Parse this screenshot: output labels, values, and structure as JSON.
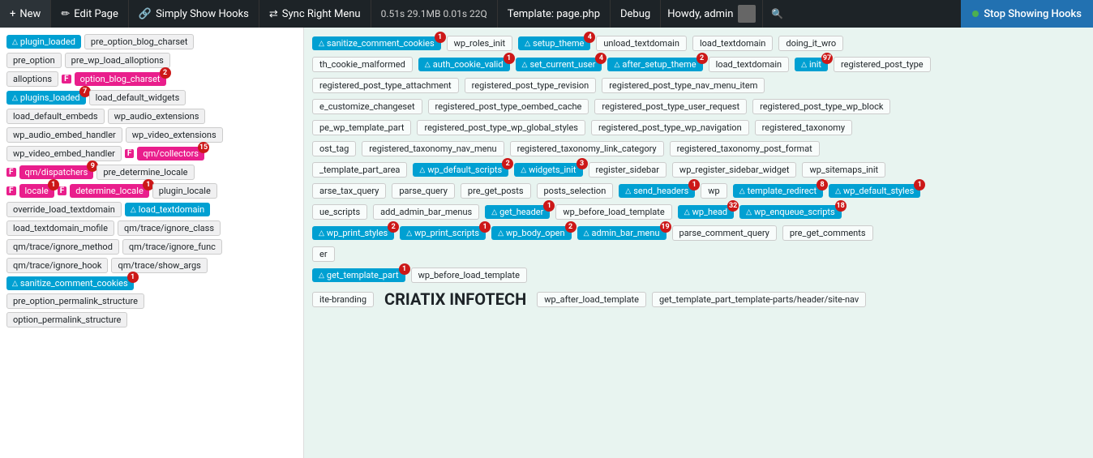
{
  "toolbar": {
    "new_label": "New",
    "edit_page_label": "Edit Page",
    "simply_show_hooks_label": "Simply Show Hooks",
    "sync_right_menu_label": "Sync Right Menu",
    "stats": "0.51s  29.1MB  0.01s  22Q",
    "template_label": "Template:  page.php",
    "debug_label": "Debug",
    "admin_label": "Howdy, admin",
    "stop_hooks_label": "Stop Showing Hooks"
  },
  "left_hooks": [
    [
      {
        "text": "plugin_loaded",
        "type": "action"
      },
      {
        "text": "pre_option_blog_charset",
        "type": "neutral"
      }
    ],
    [
      {
        "text": "pre_option",
        "type": "neutral"
      },
      {
        "text": "pre_wp_load_alloptions",
        "type": "neutral"
      }
    ],
    [
      {
        "text": "alloptions",
        "type": "neutral"
      },
      {
        "text": "F",
        "type": "f-prefix"
      },
      {
        "text": "option_blog_charset",
        "type": "filter",
        "badge": "2"
      }
    ],
    [
      {
        "text": "plugins_loaded",
        "type": "action",
        "badge": "7"
      },
      {
        "text": "load_default_widgets",
        "type": "neutral"
      }
    ],
    [
      {
        "text": "load_default_embeds",
        "type": "neutral"
      },
      {
        "text": "wp_audio_extensions",
        "type": "neutral"
      }
    ],
    [
      {
        "text": "wp_audio_embed_handler",
        "type": "neutral"
      },
      {
        "text": "wp_video_extensions",
        "type": "neutral"
      }
    ],
    [
      {
        "text": "wp_video_embed_handler",
        "type": "neutral"
      },
      {
        "text": "F",
        "type": "f-prefix"
      },
      {
        "text": "qm/collectors",
        "type": "filter",
        "badge": "15"
      }
    ],
    [
      {
        "text": "F",
        "type": "f-prefix"
      },
      {
        "text": "qm/dispatchers",
        "type": "filter",
        "badge": "9"
      },
      {
        "text": "pre_determine_locale",
        "type": "neutral"
      }
    ],
    [
      {
        "text": "F",
        "type": "f-prefix"
      },
      {
        "text": "locale",
        "type": "filter",
        "badge": "1"
      },
      {
        "text": "F",
        "type": "f-prefix"
      },
      {
        "text": "determine_locale",
        "type": "filter",
        "badge": "1"
      },
      {
        "text": "plugin_locale",
        "type": "neutral"
      }
    ],
    [
      {
        "text": "override_load_textdomain",
        "type": "neutral"
      },
      {
        "text": "load_textdomain",
        "type": "action"
      }
    ],
    [
      {
        "text": "load_textdomain_mofile",
        "type": "neutral"
      },
      {
        "text": "qm/trace/ignore_class",
        "type": "neutral"
      }
    ],
    [
      {
        "text": "qm/trace/ignore_method",
        "type": "neutral"
      },
      {
        "text": "qm/trace/ignore_func",
        "type": "neutral"
      }
    ],
    [
      {
        "text": "qm/trace/ignore_hook",
        "type": "neutral"
      },
      {
        "text": "qm/trace/show_args",
        "type": "neutral"
      }
    ],
    [
      {
        "text": "sanitize_comment_cookies",
        "type": "action",
        "badge": "1"
      }
    ],
    [
      {
        "text": "pre_option_permalink_structure",
        "type": "neutral"
      }
    ],
    [
      {
        "text": "option_permalink_structure",
        "type": "neutral"
      }
    ]
  ],
  "right_hooks": [
    {
      "line": [
        {
          "text": "sanitize_comment_cookies",
          "type": "action",
          "badge": "1"
        },
        {
          "text": "wp_roles_init",
          "type": "neutral"
        },
        {
          "text": "setup_theme",
          "type": "action",
          "badge": "4"
        },
        {
          "text": "unload_textdomain",
          "type": "neutral"
        },
        {
          "text": "load_textdomain",
          "type": "neutral"
        },
        {
          "text": "doing_it_wro",
          "type": "neutral"
        }
      ]
    },
    {
      "line": [
        {
          "text": "th_cookie_malformed",
          "type": "neutral"
        },
        {
          "text": "auth_cookie_valid",
          "type": "action",
          "badge": "1"
        },
        {
          "text": "set_current_user",
          "type": "action",
          "badge": "4"
        },
        {
          "text": "after_setup_theme",
          "type": "action",
          "badge": "2"
        },
        {
          "text": "load_textdomain",
          "type": "neutral"
        },
        {
          "text": "init",
          "type": "action",
          "badge": "97"
        },
        {
          "text": "registered_post_type",
          "type": "neutral"
        }
      ]
    },
    {
      "line": [
        {
          "text": "registered_post_type_attachment",
          "type": "neutral"
        },
        {
          "text": "registered_post_type_revision",
          "type": "neutral"
        },
        {
          "text": "registered_post_type_nav_menu_item",
          "type": "neutral"
        }
      ]
    },
    {
      "line": [
        {
          "text": "e_customize_changeset",
          "type": "neutral"
        },
        {
          "text": "registered_post_type_oembed_cache",
          "type": "neutral"
        },
        {
          "text": "registered_post_type_user_request",
          "type": "neutral"
        },
        {
          "text": "registered_post_type_wp_block",
          "type": "neutral"
        }
      ]
    },
    {
      "line": [
        {
          "text": "pe_wp_template_part",
          "type": "neutral"
        },
        {
          "text": "registered_post_type_wp_global_styles",
          "type": "neutral"
        },
        {
          "text": "registered_post_type_wp_navigation",
          "type": "neutral"
        },
        {
          "text": "registered_taxonomy",
          "type": "neutral"
        }
      ]
    },
    {
      "line": [
        {
          "text": "ost_tag",
          "type": "neutral"
        },
        {
          "text": "registered_taxonomy_nav_menu",
          "type": "neutral"
        },
        {
          "text": "registered_taxonomy_link_category",
          "type": "neutral"
        },
        {
          "text": "registered_taxonomy_post_format",
          "type": "neutral"
        }
      ]
    },
    {
      "line": [
        {
          "text": "_template_part_area",
          "type": "neutral"
        },
        {
          "text": "wp_default_scripts",
          "type": "action",
          "badge": "2"
        },
        {
          "text": "widgets_init",
          "type": "action",
          "badge": "3"
        },
        {
          "text": "register_sidebar",
          "type": "neutral"
        },
        {
          "text": "wp_register_sidebar_widget",
          "type": "neutral"
        },
        {
          "text": "wp_sitemaps_init",
          "type": "neutral"
        }
      ]
    },
    {
      "line": [
        {
          "text": "arse_tax_query",
          "type": "neutral"
        },
        {
          "text": "parse_query",
          "type": "neutral"
        },
        {
          "text": "pre_get_posts",
          "type": "neutral"
        },
        {
          "text": "posts_selection",
          "type": "neutral"
        },
        {
          "text": "send_headers",
          "type": "action",
          "badge": "1"
        },
        {
          "text": "wp",
          "type": "neutral"
        },
        {
          "text": "template_redirect",
          "type": "action",
          "badge": "8"
        },
        {
          "text": "wp_default_styles",
          "type": "action",
          "badge": "1"
        }
      ]
    },
    {
      "line": [
        {
          "text": "ue_scripts",
          "type": "neutral"
        },
        {
          "text": "add_admin_bar_menus",
          "type": "neutral"
        },
        {
          "text": "get_header",
          "type": "action",
          "badge": "1"
        },
        {
          "text": "wp_before_load_template",
          "type": "neutral"
        },
        {
          "text": "wp_head",
          "type": "action",
          "badge": "32"
        },
        {
          "text": "wp_enqueue_scripts",
          "type": "action",
          "badge": "18"
        }
      ]
    },
    {
      "line": [
        {
          "text": "wp_print_styles",
          "type": "action",
          "badge": "2"
        },
        {
          "text": "wp_print_scripts",
          "type": "action",
          "badge": "1"
        },
        {
          "text": "wp_body_open",
          "type": "action",
          "badge": "2"
        },
        {
          "text": "admin_bar_menu",
          "type": "action",
          "badge": "19"
        },
        {
          "text": "parse_comment_query",
          "type": "neutral"
        },
        {
          "text": "pre_get_comments",
          "type": "neutral"
        }
      ]
    },
    {
      "line": [
        {
          "text": "er",
          "type": "neutral"
        }
      ]
    },
    {
      "line": [
        {
          "text": "get_template_part",
          "type": "action",
          "badge": "1"
        },
        {
          "text": "wp_before_load_template",
          "type": "neutral"
        }
      ]
    },
    {
      "line": []
    },
    {
      "line": [
        {
          "text": "ite-branding",
          "type": "neutral"
        },
        {
          "text": "CRIATIX INFOTECH",
          "type": "title"
        },
        {
          "text": "wp_after_load_template",
          "type": "neutral"
        },
        {
          "text": "get_template_part_template-parts/header/site-nav",
          "type": "neutral"
        }
      ]
    }
  ]
}
